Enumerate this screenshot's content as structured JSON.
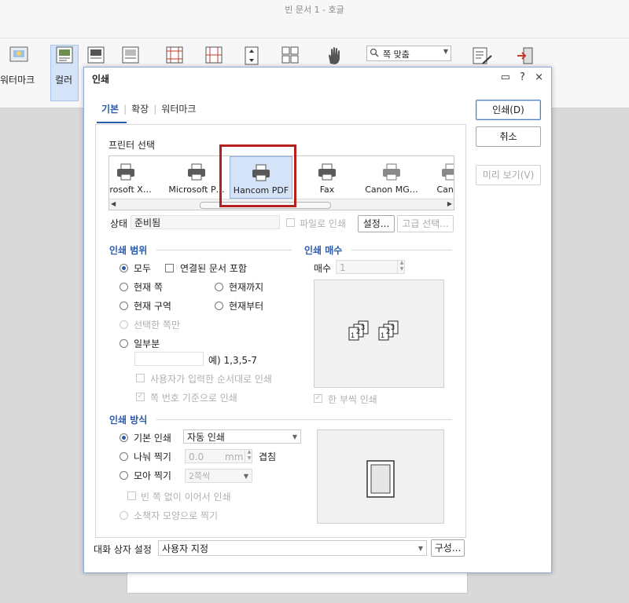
{
  "app": {
    "title": "빈 문서 1 - 호글"
  },
  "ribbon": {
    "watermark_label": "워터마크",
    "color_label": "컬러",
    "zoom_value": "쪽 맞춤"
  },
  "dialog": {
    "title": "인쇄",
    "controls": {
      "menu": "▭",
      "help": "?",
      "close": "×"
    },
    "tabs": [
      "기본",
      "확장",
      "워터마크"
    ],
    "buttons": {
      "print": "인쇄(D)",
      "cancel": "취소",
      "preview": "미리 보기(V)",
      "settings": "설정...",
      "advanced": "고급 선택...",
      "configure": "구성..."
    },
    "printer": {
      "section": "프린터 선택",
      "items": [
        {
          "name": "licrosoft X…"
        },
        {
          "name": "Microsoft P…"
        },
        {
          "name": "Hancom PDF",
          "selected": true
        },
        {
          "name": "Fax"
        },
        {
          "name": "Canon MG…"
        },
        {
          "name": "Canon"
        }
      ],
      "status_label": "상태",
      "status_value": "준비됨",
      "print_to_file": "파일로 인쇄"
    },
    "range": {
      "section": "인쇄 범위",
      "all": "모두",
      "linked": "연결된 문서 포함",
      "current_page": "현재 쪽",
      "until_current": "현재까지",
      "current_section": "현재 구역",
      "from_current": "현재부터",
      "selected_pages": "선택한 쪽만",
      "partial": "일부분",
      "example": "예) 1,3,5-7",
      "user_order": "사용자가 입력한 순서대로 인쇄",
      "page_number_basis": "쪽 번호 기준으로 인쇄"
    },
    "copies": {
      "section": "인쇄 매수",
      "label": "매수",
      "value": "1",
      "collate": "한 부씩 인쇄"
    },
    "method": {
      "section": "인쇄 방식",
      "basic": "기본 인쇄",
      "basic_value": "자동 인쇄",
      "split": "나눠 찍기",
      "split_value": "0.0",
      "split_unit": "mm",
      "overlap": "겹침",
      "gather": "모아 찍기",
      "gather_value": "2쪽씩",
      "continuous": "빈 쪽 없이 이어서 인쇄",
      "booklet": "소책자 모양으로 찍기"
    },
    "footer": {
      "label": "대화 상자 설정",
      "value": "사용자 지정"
    }
  }
}
